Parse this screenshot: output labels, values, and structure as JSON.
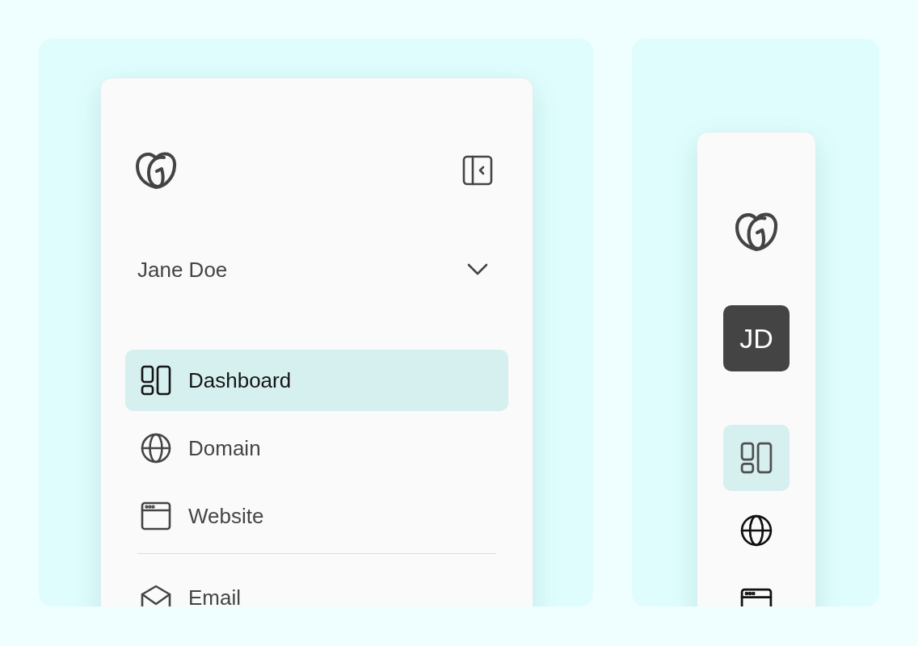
{
  "expanded_sidebar": {
    "account": {
      "name": "Jane Doe"
    },
    "nav_sections": [
      {
        "items": [
          {
            "kind": "dashboard",
            "label": "Dashboard",
            "selected": true
          },
          {
            "kind": "domain",
            "label": "Domain",
            "selected": false
          },
          {
            "kind": "website",
            "label": "Website",
            "selected": false
          }
        ]
      },
      {
        "items": [
          {
            "kind": "email",
            "label": "Email",
            "selected": false
          }
        ]
      }
    ]
  },
  "collapsed_sidebar": {
    "avatar": {
      "initials": "JD"
    },
    "nav_items": [
      {
        "kind": "dashboard",
        "selected": true
      },
      {
        "kind": "domain",
        "selected": false
      },
      {
        "kind": "website",
        "selected": false
      }
    ]
  }
}
